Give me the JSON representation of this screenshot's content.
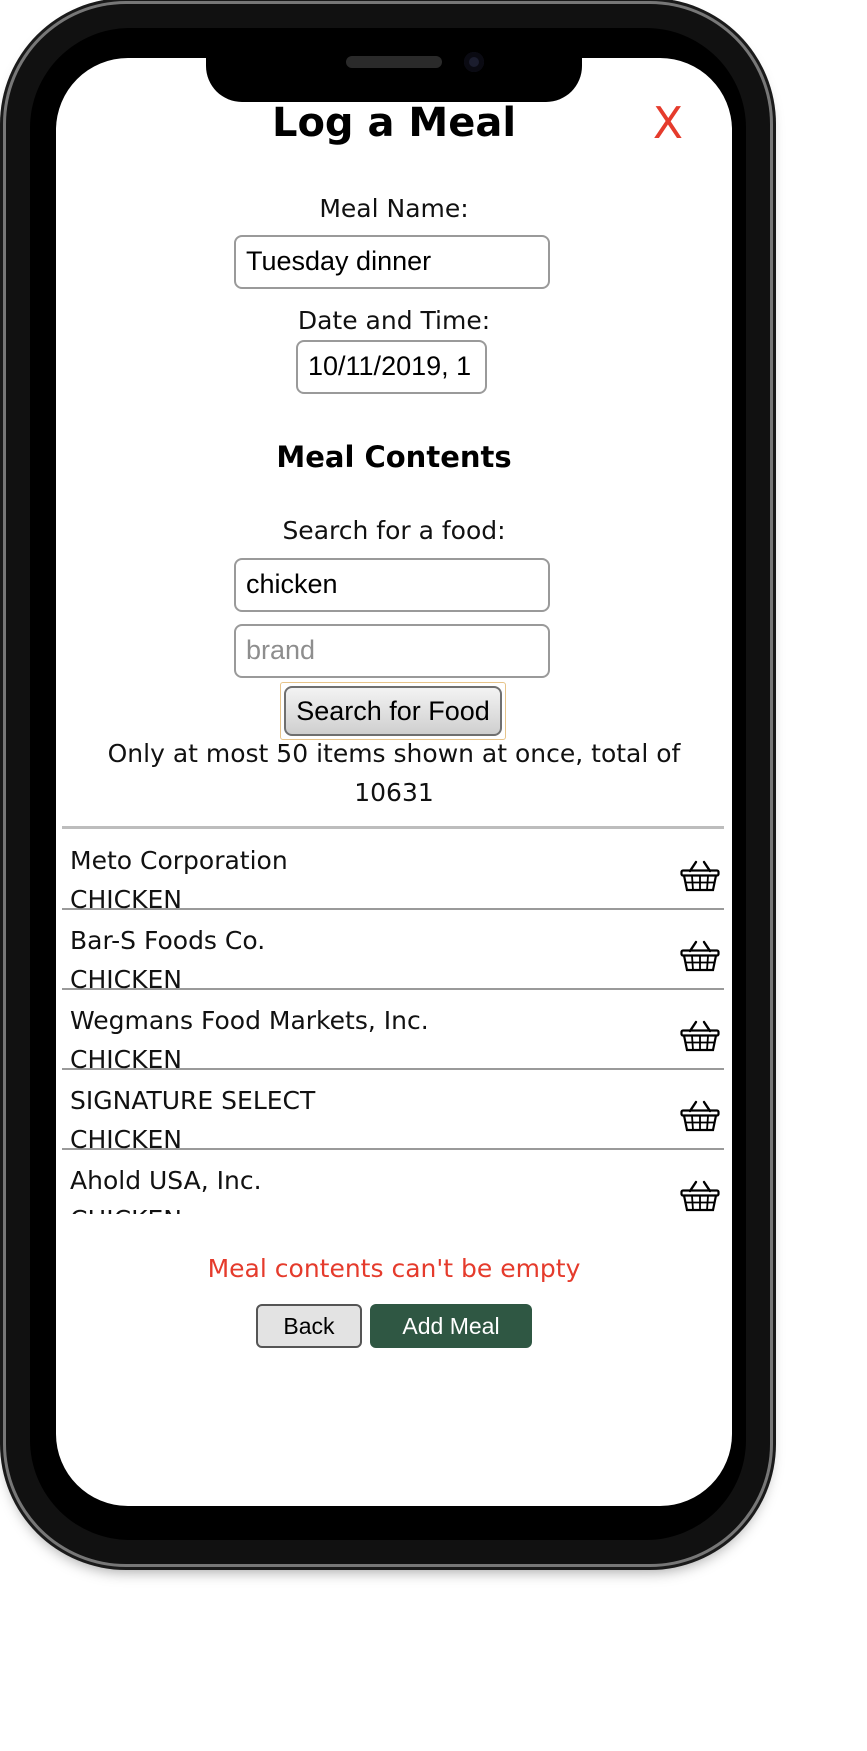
{
  "header": {
    "title": "Log a Meal",
    "close_label": "X"
  },
  "form": {
    "meal_name_label": "Meal Name:",
    "meal_name_value": "Tuesday dinner",
    "datetime_label": "Date and Time:",
    "datetime_value": "10/11/2019, 1"
  },
  "contents": {
    "heading": "Meal Contents",
    "search_label": "Search for a food:",
    "search_value": "chicken",
    "brand_placeholder": "brand",
    "search_button": "Search for Food",
    "info": "Only at most 50 items shown at once, total of 10631"
  },
  "results": [
    {
      "brand": "Meto Corporation",
      "name": "CHICKEN"
    },
    {
      "brand": "Bar-S Foods Co.",
      "name": "CHICKEN"
    },
    {
      "brand": "Wegmans Food Markets, Inc.",
      "name": "CHICKEN"
    },
    {
      "brand": "SIGNATURE SELECT",
      "name": "CHICKEN"
    },
    {
      "brand": "Ahold USA, Inc.",
      "name": "CHICKEN"
    }
  ],
  "footer": {
    "error": "Meal contents can't be empty",
    "back_button": "Back",
    "add_button": "Add Meal"
  },
  "colors": {
    "accent_red": "#e53b2c",
    "add_button_green": "#2f5743"
  },
  "icons": {
    "close": "close-x-icon",
    "add_item": "basket-icon"
  }
}
